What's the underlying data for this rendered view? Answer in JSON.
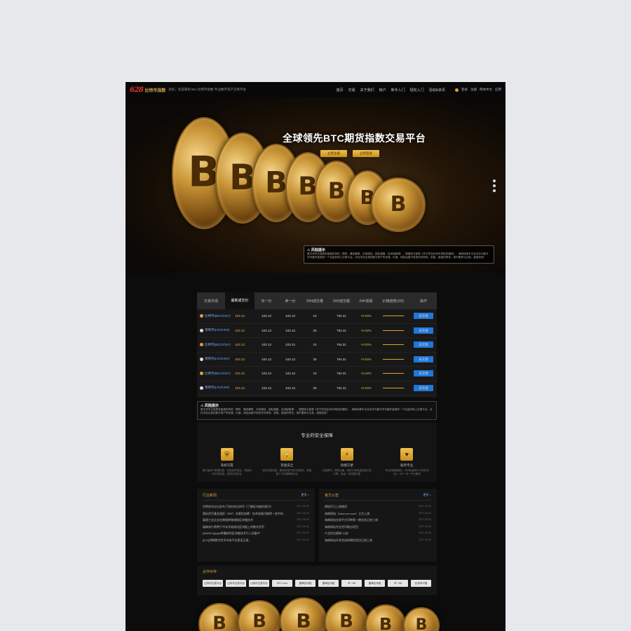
{
  "header": {
    "logo_mark": "628",
    "logo_text": "比特币指数",
    "welcome": "您好，欢迎来到 BIU 比特币指数·专业数字资产交易平台",
    "nav": [
      "首页",
      "交易",
      "关于我们",
      "帐户",
      "新手入门",
      "轻松入门",
      "活动&资讯"
    ],
    "user": [
      "登录",
      "注册",
      "简体中文",
      "应用"
    ]
  },
  "hero": {
    "title": "全球领先BTC期货指数交易平台",
    "btn_register": "立即注册",
    "btn_login": "立即登录",
    "coin_symbol": "B",
    "risk_title": "风险提示",
    "risk_text": "数字货币交易具有极高的风险（预防、暴涨暴跌、庄家操控、团队跑路、技术缺陷等），据国家五部委《关于防范比特币风险的通知》，海南特殊本平台仅作为数字货币爱好者提供一个自由的网上交换平台，对在本站交易的数字资产的来源、价值、网站运营不承担任何审查、担保、赔偿的责任；请不要参与交易，谨慎投资！"
  },
  "market": {
    "headers": [
      "交易市场",
      "最新成交价",
      "买一价",
      "卖一价",
      "24H成交量",
      "24H成交额",
      "24H涨跌",
      "价格趋势(3日)",
      "操作"
    ],
    "rows": [
      {
        "name": "比特币(BCC/CNY)",
        "price": "103.13",
        "buy": "103.13",
        "sell": "103.13",
        "vol": "10",
        "amt": "764.31",
        "chg": "+0.03%",
        "btn": "去交易",
        "icon": "gold"
      },
      {
        "name": "莱特币(LTC/CNY)",
        "price": "103.13",
        "buy": "103.13",
        "sell": "103.13",
        "vol": "30",
        "amt": "764.31",
        "chg": "+0.03%",
        "btn": "去交易",
        "icon": "white"
      },
      {
        "name": "比特币(BCC/CNY)",
        "price": "103.13",
        "buy": "103.13",
        "sell": "103.13",
        "vol": "10",
        "amt": "764.31",
        "chg": "+0.03%",
        "btn": "去交易",
        "icon": "gold"
      },
      {
        "name": "莱特币(LTC/CNY)",
        "price": "103.13",
        "buy": "103.13",
        "sell": "103.13",
        "vol": "30",
        "amt": "764.31",
        "chg": "+0.03%",
        "btn": "去交易",
        "icon": "white"
      },
      {
        "name": "比特币(BCC/CNY)",
        "price": "103.13",
        "buy": "103.13",
        "sell": "103.13",
        "vol": "10",
        "amt": "764.31",
        "chg": "+0.03%",
        "btn": "去交易",
        "icon": "gold"
      },
      {
        "name": "莱特币(LTC/CNY)",
        "price": "103.13",
        "buy": "103.13",
        "sell": "103.13",
        "vol": "30",
        "amt": "764.31",
        "chg": "+0.03%",
        "btn": "去交易",
        "icon": "white"
      }
    ]
  },
  "warning": {
    "title": "风险提示",
    "text": "数字货币交易具有极高的风险（预防、暴涨暴跌、庄家操控、团队跑路、技术缺陷等），据国家五部委《关于防范比特币风险的通知》，海南特殊本平台仅作为数字货币爱好者提供一个自由的网上交换平台，对在本站交易的数字资产的来源、价值、网站运营不承担任何审查、担保、赔偿的责任；请不要参与交易，谨慎投资！"
  },
  "security": {
    "title": "专业的安全保障",
    "items": [
      {
        "name": "系统可靠",
        "desc": "银行级用户数据加密、动态身份验证，多级风险识别控制，保障交易安全",
        "icon": "shield-icon"
      },
      {
        "name": "资金安全",
        "desc": "钱包多层加密，离线存储于银行保险柜，资金第三方托管确保安全",
        "icon": "lock-icon"
      },
      {
        "name": "快捷方便",
        "desc": "充值即时、提现迅速，每秒万单的高性能交易引擎，保证一切快捷方便",
        "icon": "lightning-icon"
      },
      {
        "name": "服务专业",
        "desc": "专业的客服团队，400电话和24小时在线QQ，VIP一对一专业服务",
        "icon": "heart-icon"
      }
    ]
  },
  "news": {
    "industry_title": "行业新闻",
    "industry_more": "更多 >",
    "industry_items": [
      {
        "text": "世界经济论坛发布了研究的比特币《了解区块链的潜力》",
        "date": "2017-06-20"
      },
      {
        "text": "国际货币基金组织（IMF）总裁拉加德：技术进展可能将一些中央...",
        "date": "2017-06-20"
      },
      {
        "text": "泰国工业企业在跨境转账借助区块链技术",
        "date": "2017-06-20"
      },
      {
        "text": "瑞典央行将将于今年开始测试区块链上的数字货币",
        "date": "2017-06-20"
      },
      {
        "text": "[WWDC]Apple将最新的区块链技术引入设备中",
        "date": "2017-06-20"
      },
      {
        "text": "[ICO]判断数字货币市场平台是否正规...",
        "date": "2017-06-20"
      }
    ],
    "notice_title": "官方公告",
    "notice_more": "更多 >",
    "notice_items": [
      {
        "text": "德铭币已上线使用",
        "date": "2017-06-20"
      },
      {
        "text": "海南网站（www.xxx.com）正式上线",
        "date": "2017-06-20"
      },
      {
        "text": "海南网站交易平台币种第一期业务已经上线",
        "date": "2017-06-20"
      },
      {
        "text": "海南网站专业货币推出项目",
        "date": "2017-06-20"
      },
      {
        "text": "产品优化更新“公告”",
        "date": "2017-06-20"
      },
      {
        "text": "海南网站开发完成的期货项目已经上线",
        "date": "2017-06-20"
      }
    ]
  },
  "partners": {
    "title": "合作伙伴",
    "items": [
      "比特币交易平台",
      "比特币交易平台",
      "比特币交易平台",
      "BTC.com",
      "雷锋区块链",
      "雷锋区块链",
      "币一58",
      "雷锋区块链",
      "币一58",
      "比特币中国"
    ]
  }
}
